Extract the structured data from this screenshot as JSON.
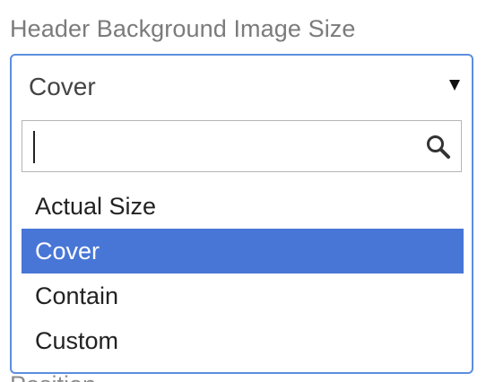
{
  "field": {
    "label": "Header Background Image Size",
    "selected_value": "Cover"
  },
  "dropdown": {
    "search_value": "",
    "search_icon": "search-icon",
    "highlighted_index": 1,
    "highlight_color": "#4876d6",
    "border_color": "#5b8ee0",
    "options": [
      {
        "label": "Actual Size"
      },
      {
        "label": "Cover"
      },
      {
        "label": "Contain"
      },
      {
        "label": "Custom"
      }
    ]
  },
  "next_field": {
    "label": "Position"
  }
}
